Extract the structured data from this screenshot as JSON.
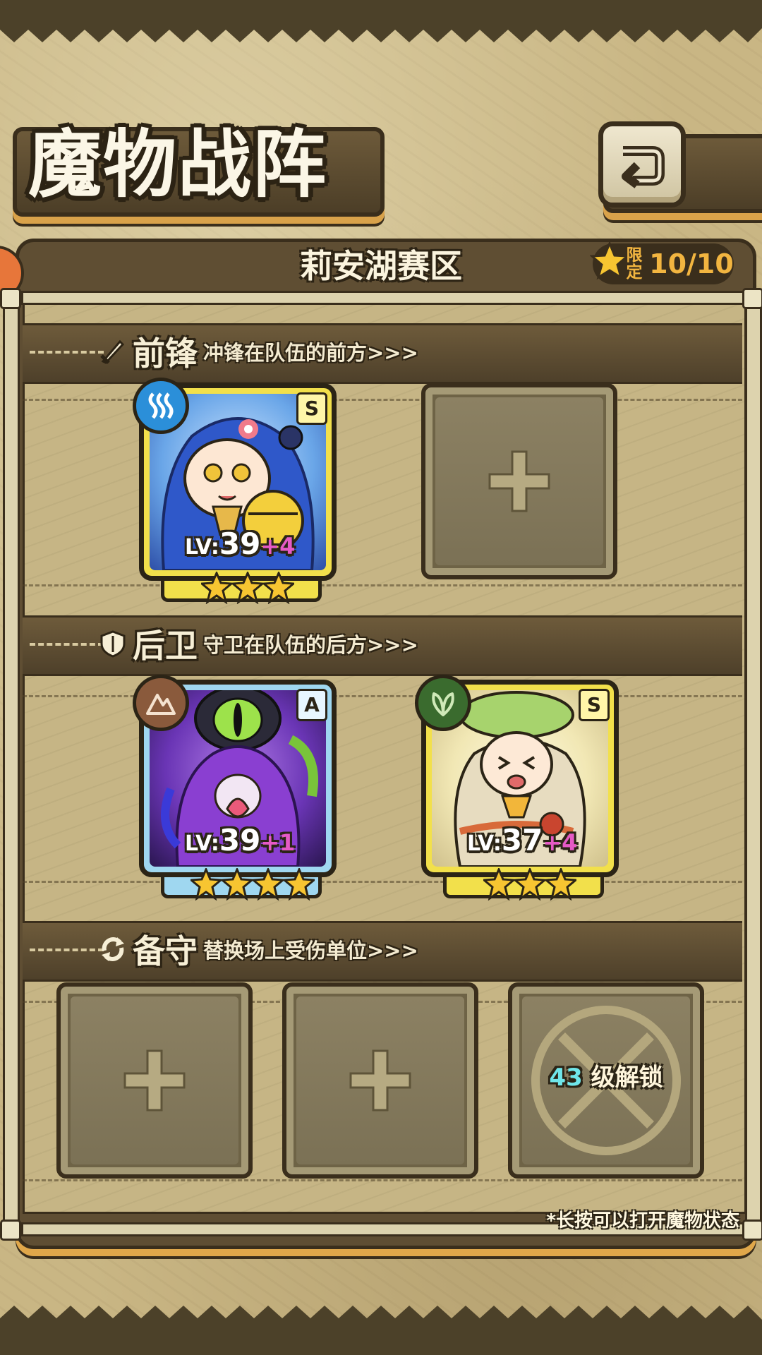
{
  "header": {
    "title": "魔物战阵",
    "back_icon": "back-arrow-icon"
  },
  "region": {
    "name": "莉安湖赛区",
    "limit_label": "限定",
    "limit_count": "10/10"
  },
  "sections": {
    "front": {
      "title": "前锋",
      "desc": "冲锋在队伍的前方>>>",
      "icon": "sword-icon"
    },
    "back": {
      "title": "后卫",
      "desc": "守卫在队伍的后方>>>",
      "icon": "shield-icon"
    },
    "reserve": {
      "title": "备守",
      "desc": "替换场上受伤单位>>>",
      "icon": "swap-icon"
    }
  },
  "cards": {
    "front1": {
      "rank": "S",
      "lv_prefix": "LV:",
      "level": "39",
      "bonus": "+4",
      "stars": 3,
      "element": "water-icon",
      "frame": "#f2e04b"
    },
    "back1": {
      "rank": "A",
      "lv_prefix": "LV:",
      "level": "39",
      "bonus": "+1",
      "stars": 4,
      "element": "earth-icon",
      "frame": "#9fd7f0"
    },
    "back2": {
      "rank": "S",
      "lv_prefix": "LV:",
      "level": "37",
      "bonus": "+4",
      "stars": 3,
      "element": "leaf-icon",
      "frame": "#f2e04b"
    }
  },
  "locked_slot": {
    "level": "43",
    "text": "级解锁"
  },
  "hint": "*长按可以打开魔物状态",
  "colors": {
    "accent": "#e0a74a",
    "dark": "#3a2e1c",
    "star": "#f7c531",
    "bonus": "#e65ac6",
    "unlock_level": "#6fe6ea"
  }
}
